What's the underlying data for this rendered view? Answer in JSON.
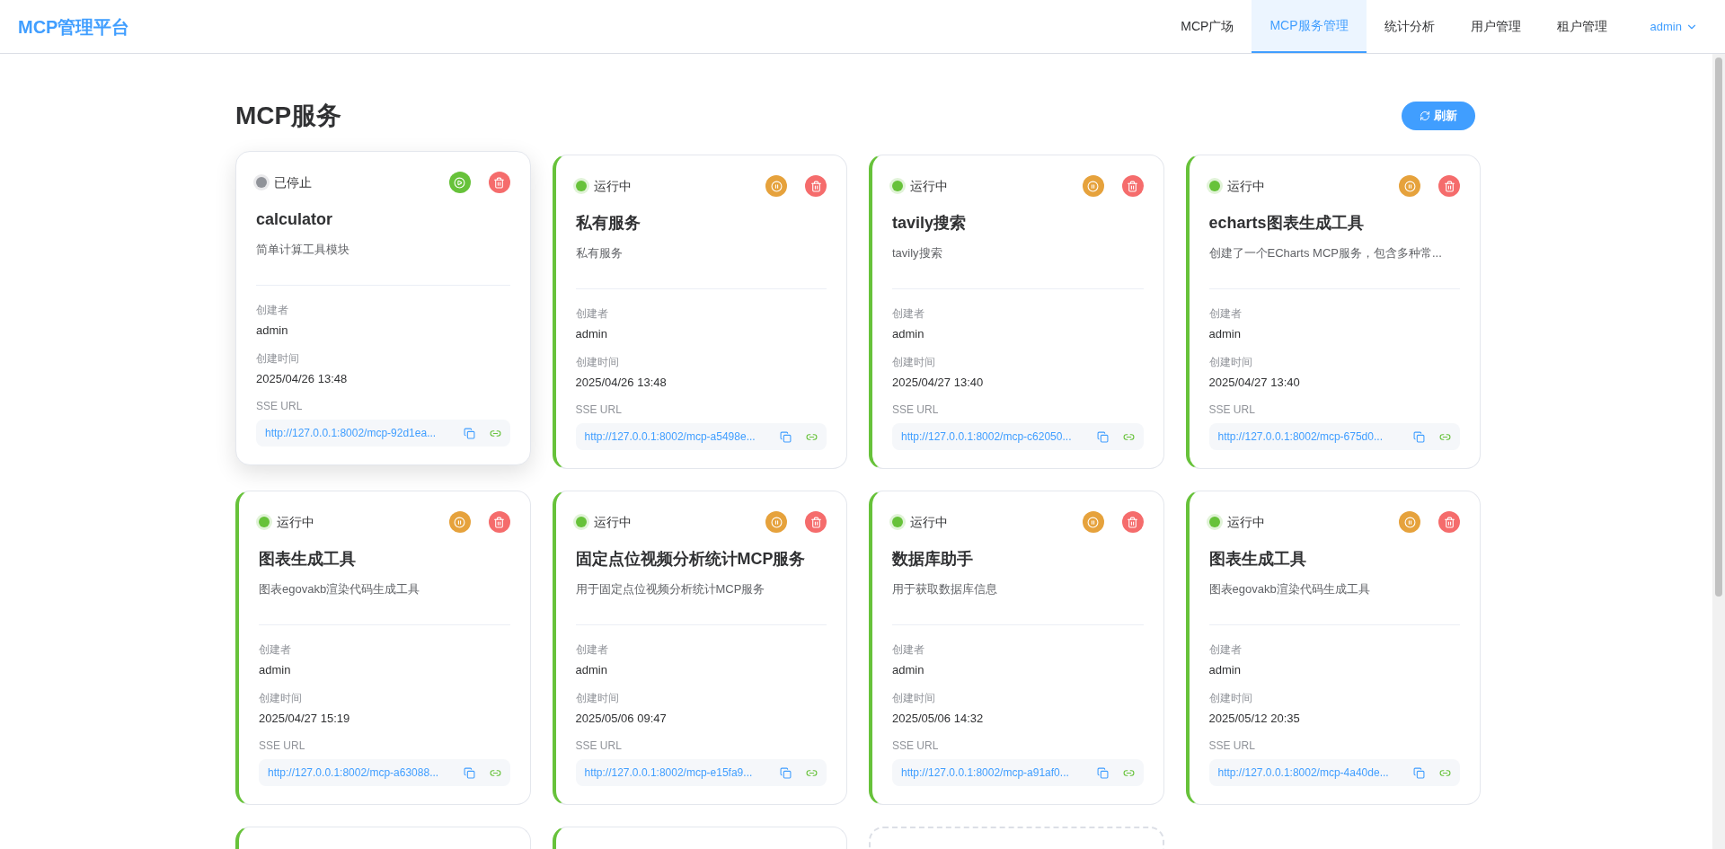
{
  "header": {
    "logo": "MCP管理平台",
    "nav": [
      {
        "label": "MCP广场",
        "selected": false
      },
      {
        "label": "MCP服务管理",
        "selected": true
      },
      {
        "label": "统计分析",
        "selected": false
      },
      {
        "label": "用户管理",
        "selected": false
      },
      {
        "label": "租户管理",
        "selected": false
      }
    ],
    "user": "admin"
  },
  "page": {
    "title": "MCP服务",
    "refresh": "刷新"
  },
  "services": [
    {
      "status": "已停止",
      "running": false,
      "hovered": true,
      "name": "calculator",
      "description": "简单计算工具模块",
      "creator_label": "创建者",
      "creator": "admin",
      "time_label": "创建时间",
      "time": "2025/04/26 13:48",
      "url_label": "SSE URL",
      "url": "http://127.0.0.1:8002/mcp-92d1ea..."
    },
    {
      "status": "运行中",
      "running": true,
      "hovered": false,
      "name": "私有服务",
      "description": "私有服务",
      "creator_label": "创建者",
      "creator": "admin",
      "time_label": "创建时间",
      "time": "2025/04/26 13:48",
      "url_label": "SSE URL",
      "url": "http://127.0.0.1:8002/mcp-a5498e..."
    },
    {
      "status": "运行中",
      "running": true,
      "hovered": false,
      "name": "tavily搜索",
      "description": "tavily搜索",
      "creator_label": "创建者",
      "creator": "admin",
      "time_label": "创建时间",
      "time": "2025/04/27 13:40",
      "url_label": "SSE URL",
      "url": "http://127.0.0.1:8002/mcp-c62050..."
    },
    {
      "status": "运行中",
      "running": true,
      "hovered": false,
      "name": "echarts图表生成工具",
      "description": "创建了一个ECharts MCP服务，包含多种常...",
      "creator_label": "创建者",
      "creator": "admin",
      "time_label": "创建时间",
      "time": "2025/04/27 13:40",
      "url_label": "SSE URL",
      "url": "http://127.0.0.1:8002/mcp-675d0..."
    },
    {
      "status": "运行中",
      "running": true,
      "hovered": false,
      "name": "图表生成工具",
      "description": "图表egovakb渲染代码生成工具",
      "creator_label": "创建者",
      "creator": "admin",
      "time_label": "创建时间",
      "time": "2025/04/27 15:19",
      "url_label": "SSE URL",
      "url": "http://127.0.0.1:8002/mcp-a63088..."
    },
    {
      "status": "运行中",
      "running": true,
      "hovered": false,
      "name": "固定点位视频分析统计MCP服务",
      "description": "用于固定点位视频分析统计MCP服务",
      "creator_label": "创建者",
      "creator": "admin",
      "time_label": "创建时间",
      "time": "2025/05/06 09:47",
      "url_label": "SSE URL",
      "url": "http://127.0.0.1:8002/mcp-e15fa9..."
    },
    {
      "status": "运行中",
      "running": true,
      "hovered": false,
      "name": "数据库助手",
      "description": "用于获取数据库信息",
      "creator_label": "创建者",
      "creator": "admin",
      "time_label": "创建时间",
      "time": "2025/05/06 14:32",
      "url_label": "SSE URL",
      "url": "http://127.0.0.1:8002/mcp-a91af0..."
    },
    {
      "status": "运行中",
      "running": true,
      "hovered": false,
      "name": "图表生成工具",
      "description": "图表egovakb渲染代码生成工具",
      "creator_label": "创建者",
      "creator": "admin",
      "time_label": "创建时间",
      "time": "2025/05/12 20:35",
      "url_label": "SSE URL",
      "url": "http://127.0.0.1:8002/mcp-4a40de..."
    }
  ],
  "partial_cards": [
    {
      "kind": "service",
      "running": true
    },
    {
      "kind": "service",
      "running": true
    },
    {
      "kind": "add"
    }
  ]
}
